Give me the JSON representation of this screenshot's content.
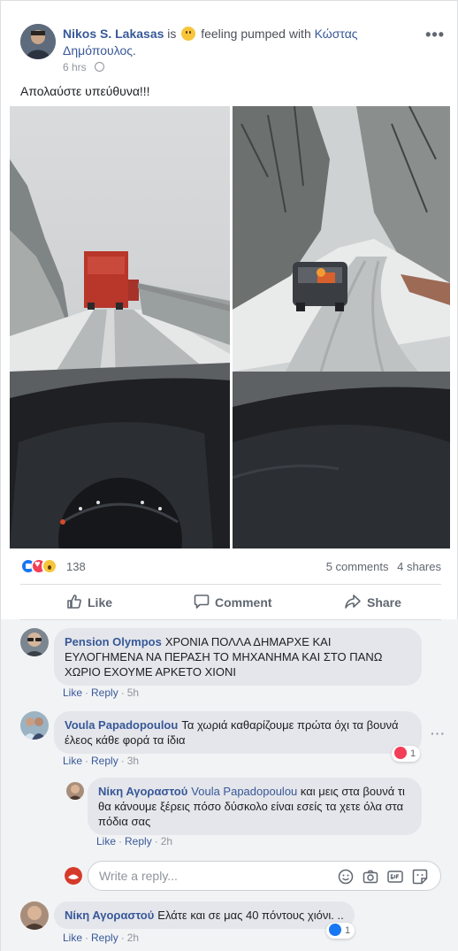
{
  "post": {
    "author": "Nikos S. Lakasas",
    "is": "is",
    "feeling": "feeling pumped with",
    "tagged": "Κώστας Δημόπουλος.",
    "time": "6 hrs",
    "more": "•••",
    "text": "Απολαύστε υπεύθυνα!!!",
    "photos": [
      "snow-road-truck-photo",
      "snow-road-jeep-photo"
    ]
  },
  "stats": {
    "reaction_count": "138",
    "comments": "5 comments",
    "shares": "4 shares",
    "reactions": [
      "like",
      "love",
      "wow"
    ]
  },
  "actions": {
    "like": "Like",
    "comment": "Comment",
    "share": "Share"
  },
  "comments": [
    {
      "name": "Pension Olympos",
      "text": "ΧΡΟΝΙΑ ΠΟΛΛΑ ΔΗΜΑΡΧΕ ΚΑΙ ΕΥΛΟΓΗΜΕΝΑ ΝΑ ΠΕΡΑΣΗ ΤΟ ΜΗΧΑΝΗΜΑ ΚΑΙ ΣΤΟ ΠΑΝΩ ΧΩΡΙΟ ΕΧΟΥΜΕ ΑΡΚΕΤΟ ΧΙΟΝΙ",
      "like": "Like",
      "reply": "Reply",
      "time": "5h"
    },
    {
      "name": "Voula Papadopoulou",
      "text": "Τα χωριά καθαρίζουμε πρώτα όχι τα βουνά έλεος κάθε φορά τα ίδια",
      "like": "Like",
      "reply": "Reply",
      "time": "3h",
      "reaction_count": "1"
    },
    {
      "name": "Νίκη Αγοραστού",
      "mention": "Voula Papadopoulou",
      "text": "και μεις στα βουνά τι θα κάνουμε ξέρεις πόσο δύσκολο είναι εσείς τα χετε όλα στα πόδια σας",
      "like": "Like",
      "reply": "Reply",
      "time": "2h"
    },
    {
      "name": "Νίκη Αγοραστού",
      "text": "Ελάτε και σε μας 40 πόντους χιόνι. ..",
      "like": "Like",
      "reply": "Reply",
      "time": "2h",
      "reaction_count": "1"
    }
  ],
  "reply_box": {
    "placeholder": "Write a reply...",
    "icons": [
      "emoji-icon",
      "camera-icon",
      "gif-icon",
      "sticker-icon"
    ]
  }
}
